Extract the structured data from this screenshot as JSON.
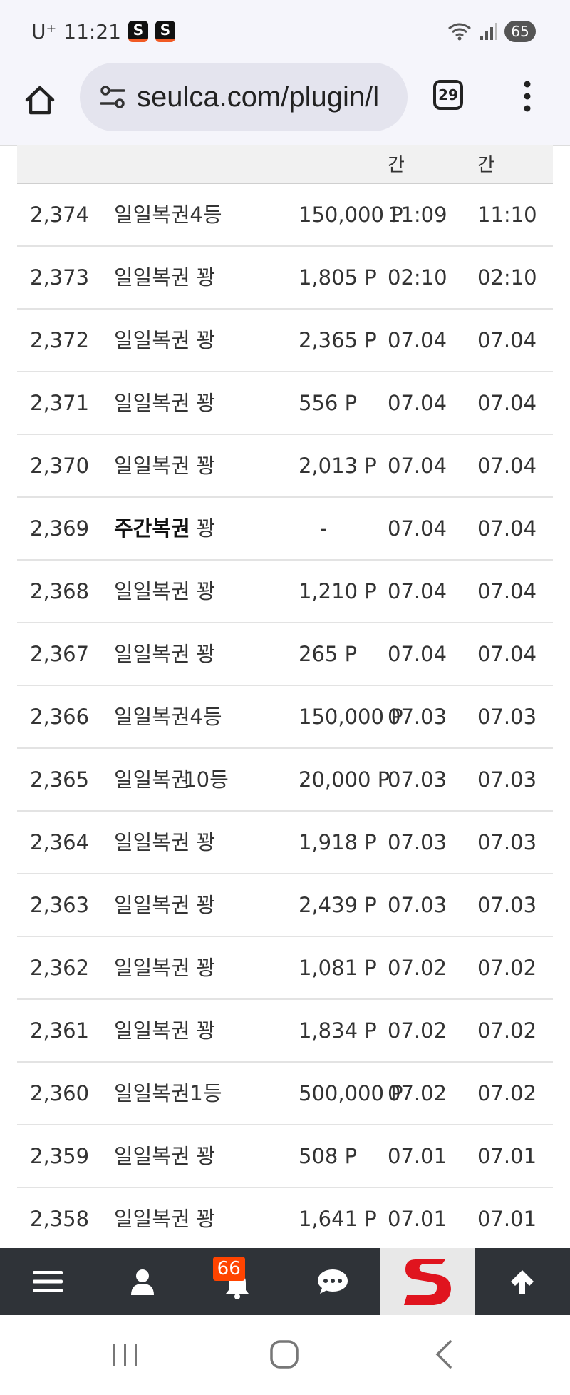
{
  "status_bar": {
    "carrier": "U⁺",
    "time": "11:21",
    "app_badges": [
      "S",
      "S"
    ],
    "battery": "65"
  },
  "browser": {
    "url": "seulca.com/plugin/l",
    "tab_count": "29"
  },
  "table": {
    "header": [
      "간",
      "간"
    ],
    "rows": [
      {
        "no": "2,374",
        "type": "일일복권",
        "rank": "4등",
        "prize": "150,000 P",
        "t1": "11:09",
        "t2": "11:10"
      },
      {
        "no": "2,373",
        "type": "일일복권",
        "rank": "꽝",
        "prize": "1,805 P",
        "t1": "02:10",
        "t2": "02:10"
      },
      {
        "no": "2,372",
        "type": "일일복권",
        "rank": "꽝",
        "prize": "2,365 P",
        "t1": "07.04",
        "t2": "07.04"
      },
      {
        "no": "2,371",
        "type": "일일복권",
        "rank": "꽝",
        "prize": "556 P",
        "t1": "07.04",
        "t2": "07.04"
      },
      {
        "no": "2,370",
        "type": "일일복권",
        "rank": "꽝",
        "prize": "2,013 P",
        "t1": "07.04",
        "t2": "07.04"
      },
      {
        "no": "2,369",
        "type": "주간복권",
        "rank": "꽝",
        "prize": "-",
        "t1": "07.04",
        "t2": "07.04"
      },
      {
        "no": "2,368",
        "type": "일일복권",
        "rank": "꽝",
        "prize": "1,210 P",
        "t1": "07.04",
        "t2": "07.04"
      },
      {
        "no": "2,367",
        "type": "일일복권",
        "rank": "꽝",
        "prize": "265 P",
        "t1": "07.04",
        "t2": "07.04"
      },
      {
        "no": "2,366",
        "type": "일일복권",
        "rank": "4등",
        "prize": "150,000 P",
        "t1": "07.03",
        "t2": "07.03"
      },
      {
        "no": "2,365",
        "type": "일일복권",
        "rank": "10등",
        "prize": "20,000 P",
        "t1": "07.03",
        "t2": "07.03"
      },
      {
        "no": "2,364",
        "type": "일일복권",
        "rank": "꽝",
        "prize": "1,918 P",
        "t1": "07.03",
        "t2": "07.03"
      },
      {
        "no": "2,363",
        "type": "일일복권",
        "rank": "꽝",
        "prize": "2,439 P",
        "t1": "07.03",
        "t2": "07.03"
      },
      {
        "no": "2,362",
        "type": "일일복권",
        "rank": "꽝",
        "prize": "1,081 P",
        "t1": "07.02",
        "t2": "07.02"
      },
      {
        "no": "2,361",
        "type": "일일복권",
        "rank": "꽝",
        "prize": "1,834 P",
        "t1": "07.02",
        "t2": "07.02"
      },
      {
        "no": "2,360",
        "type": "일일복권",
        "rank": "1등",
        "prize": "500,000 P",
        "t1": "07.02",
        "t2": "07.02"
      },
      {
        "no": "2,359",
        "type": "일일복권",
        "rank": "꽝",
        "prize": "508 P",
        "t1": "07.01",
        "t2": "07.01"
      },
      {
        "no": "2,358",
        "type": "일일복권",
        "rank": "꽝",
        "prize": "1,641 P",
        "t1": "07.01",
        "t2": "07.01"
      }
    ]
  },
  "bottom_nav": {
    "notification_count": "66",
    "items": [
      "menu-icon",
      "user-icon",
      "bell-icon",
      "chat-icon",
      "site-logo",
      "arrow-up-icon"
    ]
  },
  "colors": {
    "nav_bg": "#2f3338",
    "badge": "#ff4400",
    "logo_red": "#e0141e"
  }
}
